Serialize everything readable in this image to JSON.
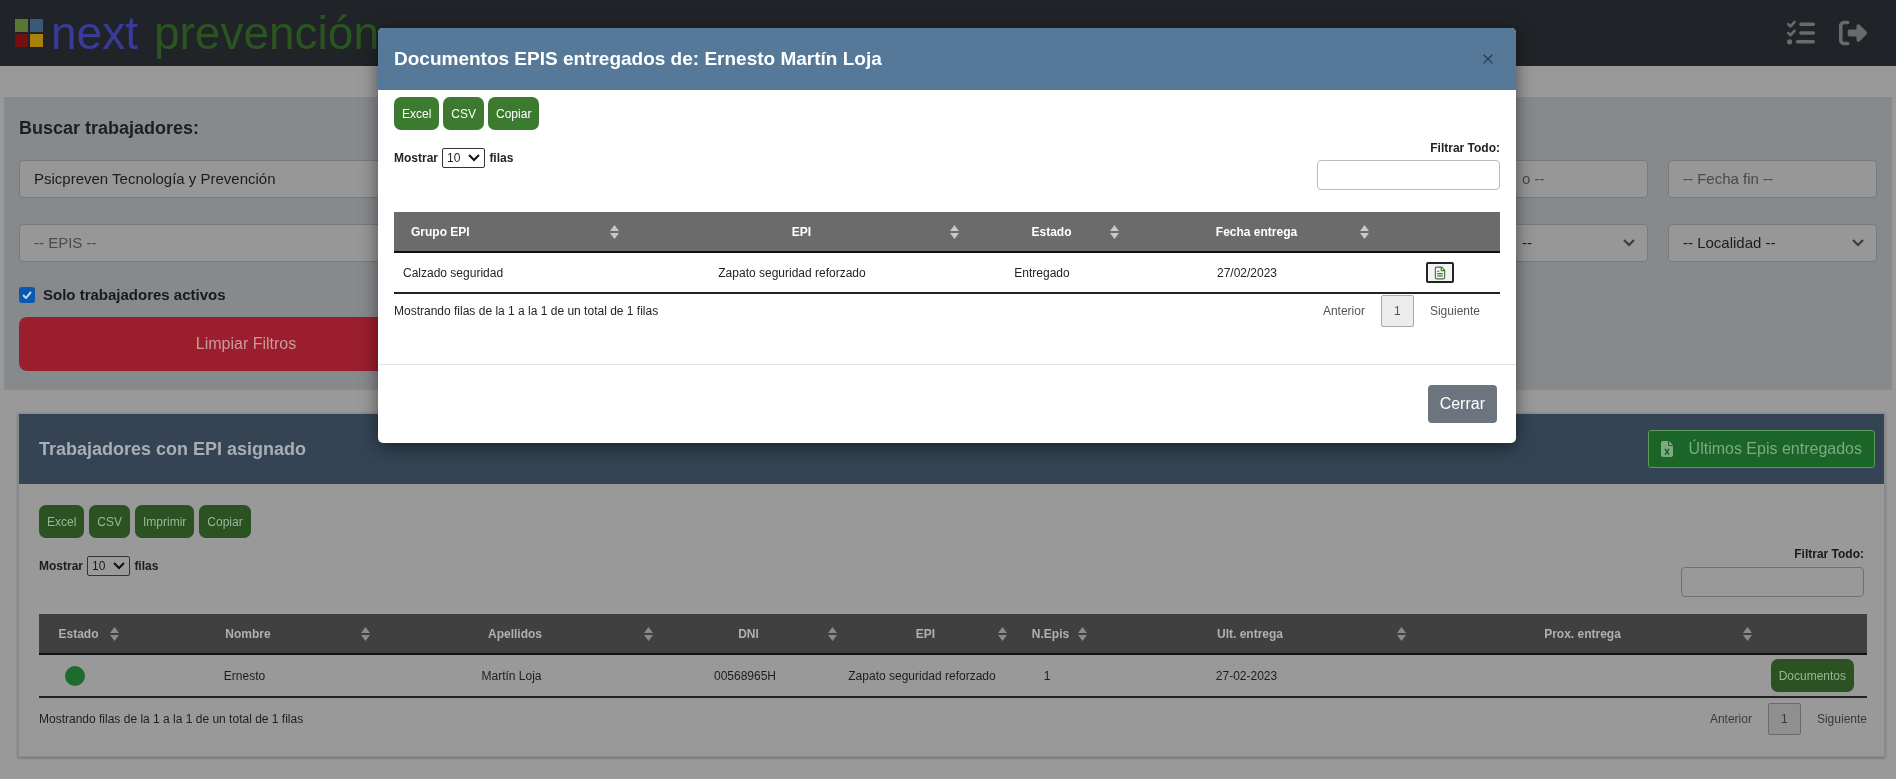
{
  "header": {
    "logo": {
      "primary": "next",
      "secondary": "prevención"
    }
  },
  "search_panel": {
    "title": "Buscar trabajadores:",
    "field_rows": [
      [
        {
          "kind": "input",
          "value": "Psicpreven Tecnología y Prevención",
          "clipped": false
        },
        {
          "kind": "input",
          "placeholder": "o --",
          "clipped": true
        },
        {
          "kind": "input",
          "placeholder": "-- Fecha fin --",
          "clipped": false
        }
      ],
      [
        {
          "kind": "input",
          "placeholder": "-- EPIS --",
          "clipped": false
        },
        {
          "kind": "select",
          "value": "--",
          "clipped": true
        },
        {
          "kind": "select",
          "value": "-- Localidad --",
          "clipped": false
        }
      ]
    ],
    "checkbox": {
      "label": "Solo trabajadores activos",
      "checked": true
    },
    "clear_button": "Limpiar Filtros"
  },
  "card": {
    "title": "Trabajadores con EPI asignado",
    "latest_button": "Últimos Epis entregados",
    "export_buttons": [
      "Excel",
      "CSV",
      "Imprimir",
      "Copiar"
    ],
    "length_menu": {
      "before": "Mostrar",
      "value": "10",
      "after": "filas"
    },
    "filter": {
      "label": "Filtrar Todo:"
    },
    "table": {
      "columns": [
        {
          "label": "Estado"
        },
        {
          "label": "Nombre"
        },
        {
          "label": "Apellidos"
        },
        {
          "label": "DNI"
        },
        {
          "label": "EPI"
        },
        {
          "label": "N.Epis"
        },
        {
          "label": "Ult. entrega"
        },
        {
          "label": "Prox. entrega"
        }
      ],
      "rows": [
        {
          "cells": [
            {
              "kind": "status",
              "color": "#1e6b2e"
            },
            {
              "kind": "text",
              "text": "Ernesto"
            },
            {
              "kind": "text",
              "text": "Martín Loja"
            },
            {
              "kind": "text",
              "text": "00568965H"
            },
            {
              "kind": "text",
              "text": "Zapato seguridad reforzado"
            },
            {
              "kind": "text",
              "text": "1"
            },
            {
              "kind": "text",
              "text": "27-02-2023"
            },
            {
              "kind": "empty"
            },
            {
              "kind": "button",
              "text": "Documentos"
            }
          ]
        }
      ]
    },
    "info": "Mostrando filas de la 1 a la 1 de un total de 1 filas",
    "pagination": {
      "prev": "Anterior",
      "pages": [
        {
          "label": "1",
          "selected": true
        }
      ],
      "next": "Siguiente"
    }
  },
  "modal": {
    "title": "Documentos EPIS entregados de: Ernesto Martín Loja",
    "export_buttons": [
      "Excel",
      "CSV",
      "Copiar"
    ],
    "length_menu": {
      "before": "Mostrar",
      "value": "10",
      "after": "filas"
    },
    "filter": {
      "label": "Filtrar Todo:"
    },
    "table": {
      "columns": [
        {
          "label": "Grupo EPI"
        },
        {
          "label": "EPI"
        },
        {
          "label": "Estado"
        },
        {
          "label": "Fecha entrega"
        }
      ],
      "rows": [
        {
          "cells": [
            "Calzado seguridad",
            "Zapato seguridad reforzado",
            "Entregado",
            "27/02/2023"
          ]
        }
      ]
    },
    "info": "Mostrando filas de la 1 a la 1 de un total de 1 filas",
    "pagination": {
      "prev": "Anterior",
      "pages": [
        {
          "label": "1",
          "selected": true
        }
      ],
      "next": "Siguiente"
    },
    "close_button": "Cerrar"
  }
}
